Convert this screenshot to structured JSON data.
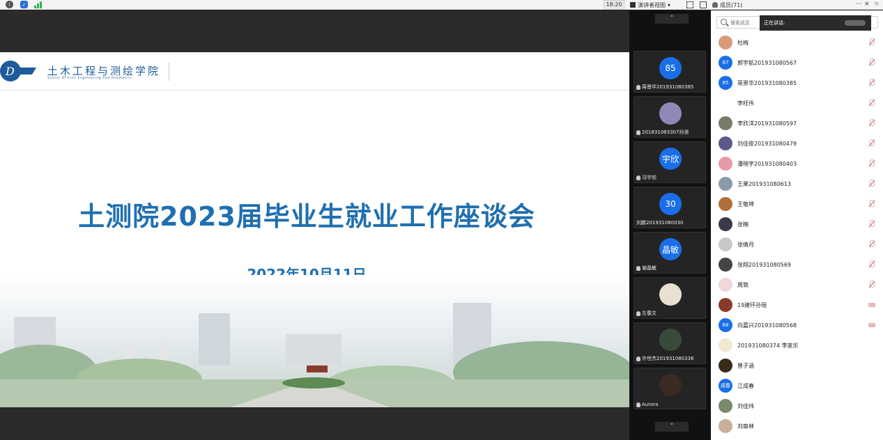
{
  "topbar": {
    "time": "18:20",
    "view_label": "演讲者视图",
    "members_label": "成员(71)",
    "more": "···",
    "close": "×",
    "menu": "≡"
  },
  "slide": {
    "school_cn": "土木工程与测绘学院",
    "school_en": "School Of Civil  Engineering And Geomatics",
    "title": "土测院2023届毕业生就业工作座谈会",
    "date": "2022年10月11日"
  },
  "strip": {
    "up": "˄",
    "down": "˅",
    "tiles": [
      {
        "avatar_text": "85",
        "name": "蒋景华201931080385",
        "blue": true
      },
      {
        "avatar_text": "",
        "name": "201831083307孙尧",
        "blue": false,
        "color": "#8f88b8"
      },
      {
        "avatar_text": "宇欣",
        "name": "冯宇欣",
        "blue": true
      },
      {
        "avatar_text": "30",
        "name": "刘鹏201931080030",
        "blue": true
      },
      {
        "avatar_text": "晶敏",
        "name": "谢晶敏",
        "blue": true
      },
      {
        "avatar_text": "",
        "name": "左春文",
        "blue": false,
        "color": "#e8e0d0"
      },
      {
        "avatar_text": "",
        "name": "许世杰201931080336",
        "blue": false,
        "color": "#3a4a3a"
      },
      {
        "avatar_text": "",
        "name": "Aurora",
        "blue": false,
        "color": "#3a2a22"
      }
    ]
  },
  "panel": {
    "search_placeholder": "搜索成员",
    "speaking_label": "正在讲话:",
    "members": [
      {
        "name": "杜梅",
        "avatar_text": "",
        "color": "#d99a7a",
        "status": "mic-off"
      },
      {
        "name": "郭宇航201931080567",
        "avatar_text": "67",
        "color": "#1a6fe8",
        "status": "mic-off"
      },
      {
        "name": "蒋景华201931080385",
        "avatar_text": "85",
        "color": "#1a6fe8",
        "status": "mic-off"
      },
      {
        "name": "李旺伟",
        "avatar_text": "",
        "color": "#ffffff",
        "status": "mic-off"
      },
      {
        "name": "李欣洋201931080597",
        "avatar_text": "",
        "color": "#7a7a6a",
        "status": "mic-off"
      },
      {
        "name": "刘佳俊201931080479",
        "avatar_text": "",
        "color": "#5a5a8a",
        "status": "mic-off"
      },
      {
        "name": "潘晓宇201931080403",
        "avatar_text": "",
        "color": "#e89aa8",
        "status": "mic-off"
      },
      {
        "name": "王果201931080613",
        "avatar_text": "",
        "color": "#8a9aa8",
        "status": "mic-off"
      },
      {
        "name": "王敬坤",
        "avatar_text": "",
        "color": "#b0703a",
        "status": "mic-off"
      },
      {
        "name": "张楠",
        "avatar_text": "",
        "color": "#3a3a4a",
        "status": "mic-off"
      },
      {
        "name": "张倩月",
        "avatar_text": "",
        "color": "#c8c8c8",
        "status": "mic-off"
      },
      {
        "name": "张翔201931080569",
        "avatar_text": "",
        "color": "#444444",
        "status": "mic-off"
      },
      {
        "name": "周致",
        "avatar_text": "",
        "color": "#f0d8d8",
        "status": "mic-off"
      },
      {
        "name": "19建环孙瑶",
        "avatar_text": "",
        "color": "#8a3a2a",
        "status": "cam"
      },
      {
        "name": "向嘉兴201931080568",
        "avatar_text": "68",
        "color": "#1a6fe8",
        "status": "cam"
      },
      {
        "name": "201931080374 李家乐",
        "avatar_text": "",
        "color": "#f0e8d0",
        "status": "none"
      },
      {
        "name": "曾子涵",
        "avatar_text": "",
        "color": "#3a2a1a",
        "status": "none"
      },
      {
        "name": "江成春",
        "avatar_text": "成春",
        "color": "#1a6fe8",
        "status": "none"
      },
      {
        "name": "刘佳炜",
        "avatar_text": "",
        "color": "#7a8a6a",
        "status": "none"
      },
      {
        "name": "刘章林",
        "avatar_text": "",
        "color": "#c8b098",
        "status": "none"
      }
    ]
  },
  "colors": {
    "accent_blue": "#1a6fe8",
    "slide_title": "#1f6fb0"
  }
}
